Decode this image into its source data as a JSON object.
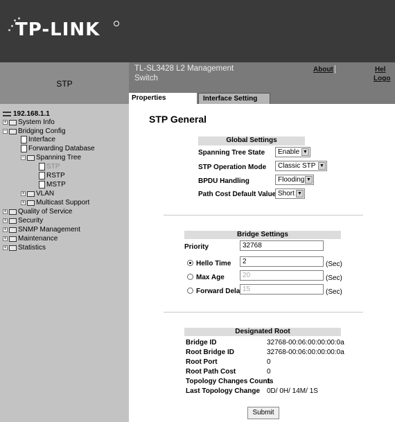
{
  "brand": {
    "logo_text": "TP-LINK"
  },
  "header": {
    "section": "STP",
    "product": "TL-SL3428 L2 Management Switch",
    "links": {
      "about": "About",
      "help": "Hel",
      "logout": "Logo"
    }
  },
  "tabs": [
    {
      "label": "Properties",
      "active": true
    },
    {
      "label": "Interface Setting",
      "active": false
    }
  ],
  "sidebar": {
    "ip": "192.168.1.1",
    "items": [
      {
        "label": "System Info"
      },
      {
        "label": "Bridging Config"
      },
      {
        "label": "Interface"
      },
      {
        "label": "Forwarding Database"
      },
      {
        "label": "Spanning Tree"
      },
      {
        "label": "STP",
        "selected": true
      },
      {
        "label": "RSTP"
      },
      {
        "label": "MSTP"
      },
      {
        "label": "VLAN"
      },
      {
        "label": "Multicast Support"
      },
      {
        "label": "Quality of Service"
      },
      {
        "label": "Security"
      },
      {
        "label": "SNMP Management"
      },
      {
        "label": "Maintenance"
      },
      {
        "label": "Statistics"
      }
    ]
  },
  "main": {
    "title": "STP General",
    "global": {
      "header": "Global Settings",
      "rows": [
        {
          "label": "Spanning Tree State",
          "value": "Enable"
        },
        {
          "label": "STP Operation Mode",
          "value": "Classic STP"
        },
        {
          "label": "BPDU Handling",
          "value": "Flooding"
        },
        {
          "label": "Path Cost Default Values",
          "value": "Short"
        }
      ]
    },
    "bridge": {
      "header": "Bridge Settings",
      "priority_label": "Priority",
      "priority_value": "32768",
      "rows": [
        {
          "label": "Hello Time",
          "value": "2",
          "unit": "(Sec)",
          "selected": true
        },
        {
          "label": "Max Age",
          "value": "20",
          "unit": "(Sec)",
          "selected": false
        },
        {
          "label": "Forward Delay",
          "value": "15",
          "unit": "(Sec)",
          "selected": false
        }
      ]
    },
    "root": {
      "header": "Designated Root",
      "rows": [
        {
          "label": "Bridge ID",
          "value": "32768-00:06:00:00:00:0a"
        },
        {
          "label": "Root Bridge ID",
          "value": "32768-00:06:00:00:00:0a"
        },
        {
          "label": "Root Port",
          "value": "0"
        },
        {
          "label": "Root Path Cost",
          "value": "0"
        },
        {
          "label": "Topology Changes Counts",
          "value": "1"
        },
        {
          "label": "Last Topology Change",
          "value": "0D/ 0H/ 14M/ 1S"
        }
      ]
    },
    "submit_label": "Submit"
  },
  "colors": {
    "header_bg": "#3a3a3a",
    "topbar_bg": "#7a7a7a",
    "sidebar_bg": "#c3c3c3",
    "section_header_bg": "#dcdcdc"
  }
}
